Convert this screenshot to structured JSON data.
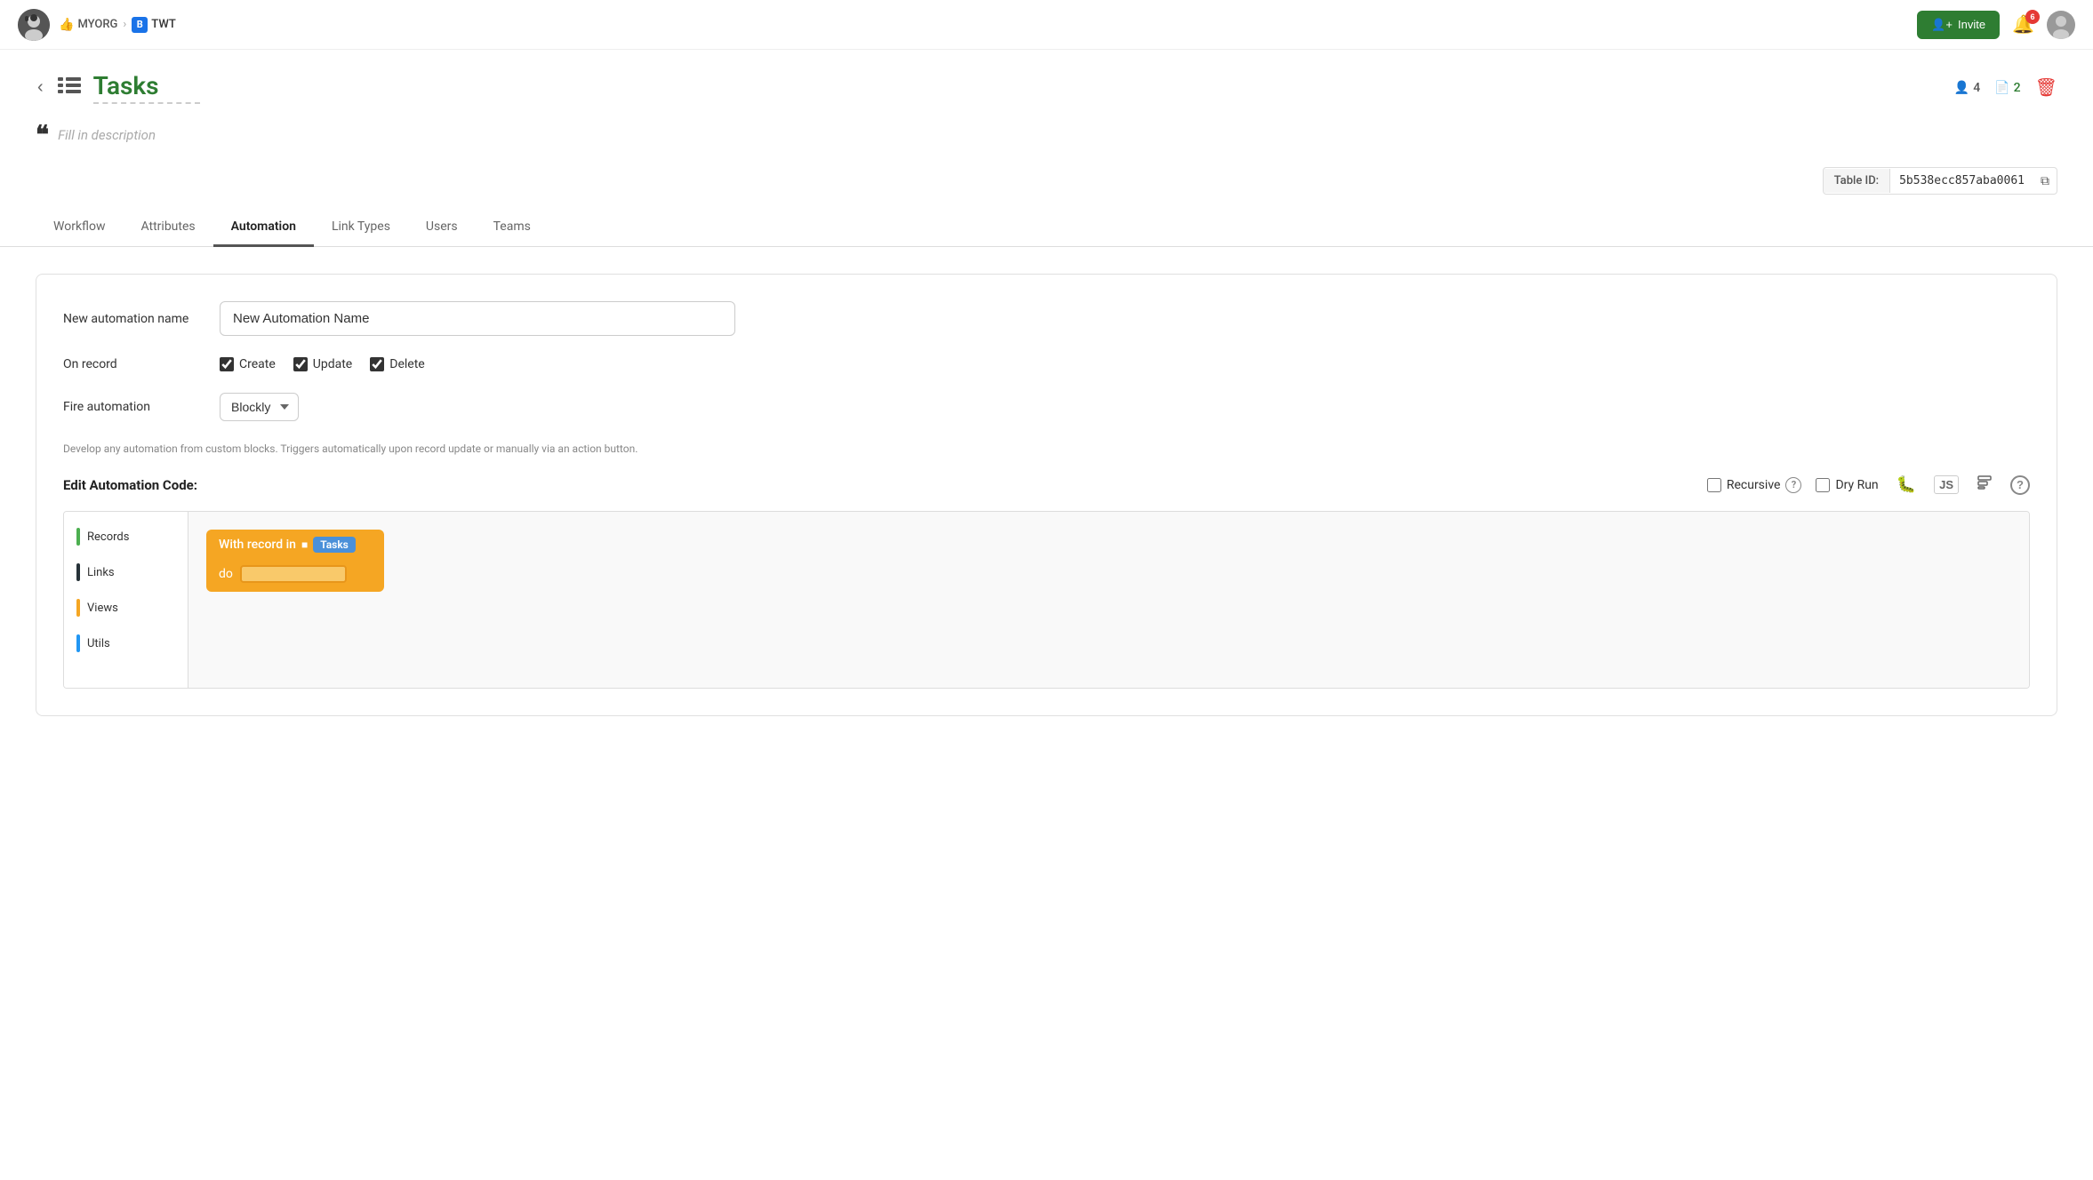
{
  "navbar": {
    "org_name": "MYORG",
    "project_name": "TWT",
    "project_badge": "B",
    "invite_label": "Invite",
    "notif_count": "6"
  },
  "page": {
    "title": "Tasks",
    "description_placeholder": "Fill in description",
    "table_id_label": "Table ID:",
    "table_id_value": "5b538ecc857aba0061",
    "members_count": "4",
    "files_count": "2"
  },
  "tabs": [
    {
      "id": "workflow",
      "label": "Workflow"
    },
    {
      "id": "attributes",
      "label": "Attributes"
    },
    {
      "id": "automation",
      "label": "Automation"
    },
    {
      "id": "link-types",
      "label": "Link Types"
    },
    {
      "id": "users",
      "label": "Users"
    },
    {
      "id": "teams",
      "label": "Teams"
    }
  ],
  "automation": {
    "name_label": "New automation name",
    "name_value": "New Automation Name",
    "on_record_label": "On record",
    "create_label": "Create",
    "update_label": "Update",
    "delete_label": "Delete",
    "fire_label": "Fire automation",
    "fire_value": "Blockly",
    "hint_text": "Develop any automation from custom blocks. Triggers automatically upon record update or manually via an action button.",
    "edit_code_title": "Edit Automation Code:",
    "recursive_label": "Recursive",
    "dry_run_label": "Dry Run",
    "question_tooltip": "?"
  },
  "blockly": {
    "sidebar_items": [
      {
        "label": "Records",
        "color": "#4caf50"
      },
      {
        "label": "Links",
        "color": "#263238"
      },
      {
        "label": "Views",
        "color": "#f5a623"
      },
      {
        "label": "Utils",
        "color": "#2196f3"
      }
    ],
    "block_prefix": "With record in",
    "block_table": "Tasks",
    "block_do": "do"
  }
}
